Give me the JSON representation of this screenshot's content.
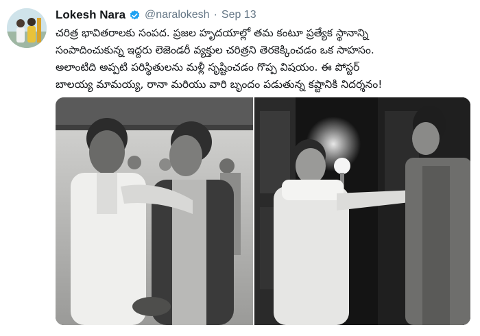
{
  "tweet": {
    "author": {
      "display_name": "Lokesh Nara",
      "handle": "@naralokesh",
      "verified": true,
      "avatar_icon": "profile-avatar"
    },
    "separator": "·",
    "date": "Sep 13",
    "text_lines": [
      "చరిత్ర భావితరాలకు సంపద. ప్రజల హృదయాల్లో తమ కంటూ ప్రత్యేక స్థానాన్ని",
      "సంపాదించుకున్న ఇద్దరు లెజెండరీ వ్యక్తుల చరిత్రని తెరకెక్కించడం ఒక సాహసం.",
      "అలాంటిది అప్పటి పరిస్థితులను మళ్లీ సృష్టించడం గొప్ప విషయం. ఈ పోస్టర్",
      "బాలయ్య మామయ్య, రానా మరియు వారి బృందం పడుతున్న కష్టానికి నిదర్శనం!"
    ],
    "media": {
      "left_photo": "vintage black-and-white photo of two men",
      "right_photo": "black-and-white film poster still of two men"
    }
  },
  "colors": {
    "text_primary": "#14171a",
    "text_secondary": "#657786",
    "verified_blue": "#1da1f2"
  }
}
